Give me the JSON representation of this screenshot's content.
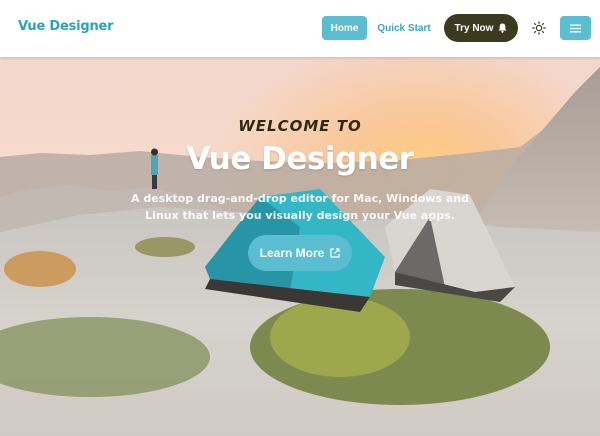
{
  "navbar": {
    "brand": "Vue Designer",
    "home_label": "Home",
    "quick_start_label": "Quick Start",
    "try_now_label": "Try Now",
    "try_now_icon": "bell-icon",
    "theme_icon": "sun-icon",
    "menu_icon": "hamburger-menu-icon"
  },
  "hero": {
    "eyebrow": "WELCOME TO",
    "title": "Vue Designer",
    "description": "A desktop drag-and-drop editor for Mac, Windows and Linux that lets you visually design your Vue apps.",
    "cta_label": "Learn More",
    "cta_icon": "external-link-icon"
  },
  "colors": {
    "accent": "#5bbdd0",
    "brand_text": "#2aa3bf",
    "dark_button": "#3b3a1f",
    "eyebrow_text": "#2c2a12"
  }
}
